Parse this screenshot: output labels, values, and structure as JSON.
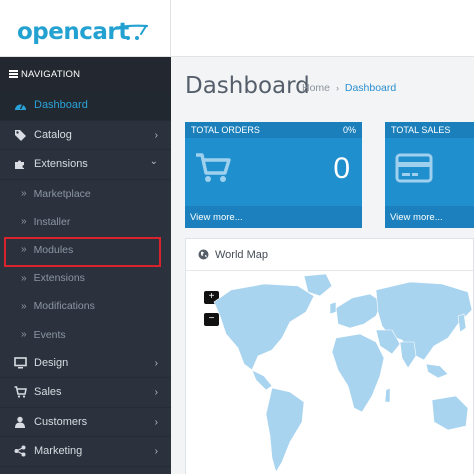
{
  "logo": {
    "text": "opencart"
  },
  "sidebar": {
    "header": "NAVIGATION",
    "items": [
      {
        "label": "Dashboard",
        "icon": "dashboard-icon",
        "active": true
      },
      {
        "label": "Catalog",
        "icon": "tags-icon",
        "chevron": "›"
      },
      {
        "label": "Extensions",
        "icon": "puzzle-icon",
        "chevron": "⌄"
      },
      {
        "label": "Design",
        "icon": "monitor-icon",
        "chevron": "›"
      },
      {
        "label": "Sales",
        "icon": "cart-icon",
        "chevron": "›"
      },
      {
        "label": "Customers",
        "icon": "user-icon",
        "chevron": "›"
      },
      {
        "label": "Marketing",
        "icon": "share-icon",
        "chevron": "›"
      }
    ],
    "subitems": [
      {
        "label": "Marketplace"
      },
      {
        "label": "Installer"
      },
      {
        "label": "Modules"
      },
      {
        "label": "Extensions"
      },
      {
        "label": "Modifications"
      },
      {
        "label": "Events"
      }
    ]
  },
  "main": {
    "title": "Dashboard",
    "breadcrumb": {
      "home": "Home",
      "sep": "›",
      "current": "Dashboard"
    },
    "tiles": [
      {
        "title": "TOTAL ORDERS",
        "pct": "0%",
        "value": "0",
        "more": "View more..."
      },
      {
        "title": "TOTAL SALES",
        "more": "View more..."
      }
    ],
    "map": {
      "title": "World Map",
      "zoom_in": "+",
      "zoom_out": "−"
    }
  },
  "colors": {
    "accent": "#23a1d1",
    "sidebar": "#2b323d",
    "tile": "#1f8fce",
    "highlight": "#d9232d",
    "map_land": "#a9d4ef"
  }
}
